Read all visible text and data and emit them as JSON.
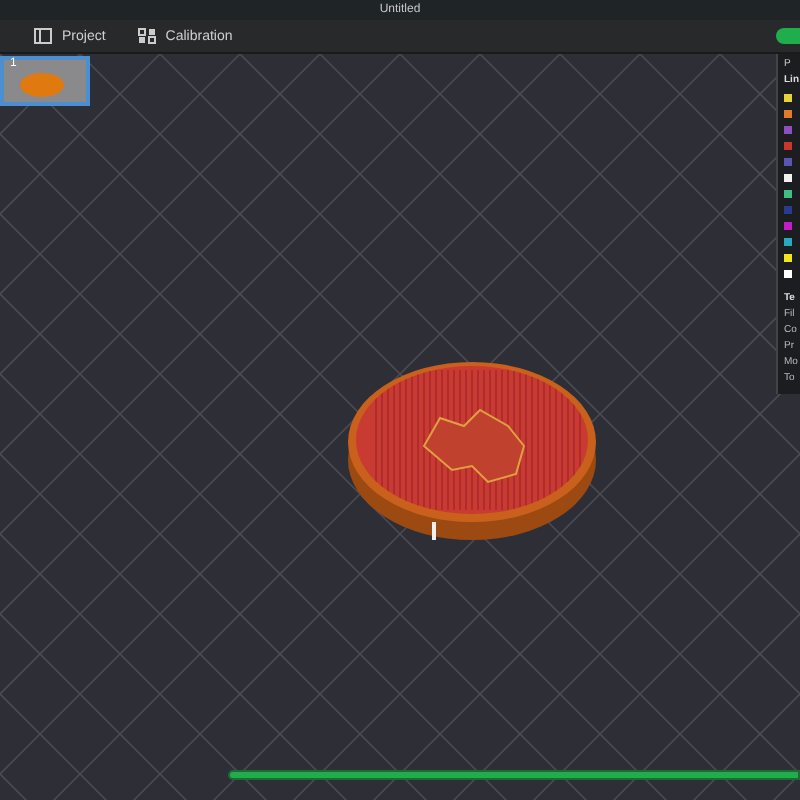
{
  "window": {
    "title": "Untitled"
  },
  "tabs": [
    {
      "label": "Project",
      "selected": false
    },
    {
      "label": "Calibration",
      "selected": false
    }
  ],
  "plates": [
    {
      "label": "1",
      "selected": true
    }
  ],
  "legend": {
    "header": "P",
    "section_title": "Lin",
    "swatches": [
      {
        "color": "#e8d23a"
      },
      {
        "color": "#e07a2c"
      },
      {
        "color": "#8c4fc0"
      },
      {
        "color": "#c8362c"
      },
      {
        "color": "#5a55b0"
      },
      {
        "color": "#f2f2f2"
      },
      {
        "color": "#3fbf86"
      },
      {
        "color": "#2a3a8c"
      },
      {
        "color": "#c21ec4"
      },
      {
        "color": "#2aa8c0"
      },
      {
        "color": "#f0e620"
      },
      {
        "color": "#ffffff"
      }
    ],
    "info_title": "Te",
    "info_rows": [
      "Fil",
      "Co",
      "Pr",
      "Mo",
      "To"
    ]
  }
}
